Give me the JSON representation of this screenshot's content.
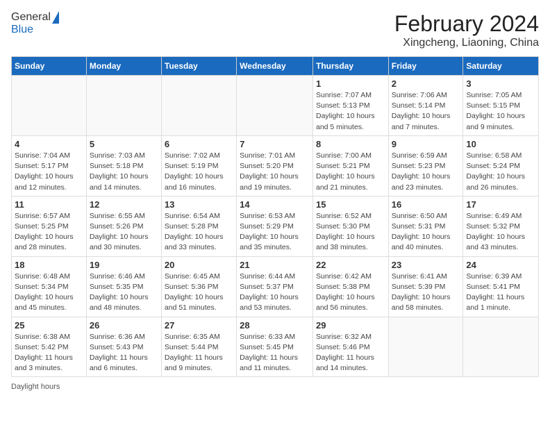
{
  "header": {
    "logo_general": "General",
    "logo_blue": "Blue",
    "title": "February 2024",
    "subtitle": "Xingcheng, Liaoning, China"
  },
  "days_of_week": [
    "Sunday",
    "Monday",
    "Tuesday",
    "Wednesday",
    "Thursday",
    "Friday",
    "Saturday"
  ],
  "weeks": [
    [
      {
        "day": "",
        "info": ""
      },
      {
        "day": "",
        "info": ""
      },
      {
        "day": "",
        "info": ""
      },
      {
        "day": "",
        "info": ""
      },
      {
        "day": "1",
        "info": "Sunrise: 7:07 AM\nSunset: 5:13 PM\nDaylight: 10 hours and 5 minutes."
      },
      {
        "day": "2",
        "info": "Sunrise: 7:06 AM\nSunset: 5:14 PM\nDaylight: 10 hours and 7 minutes."
      },
      {
        "day": "3",
        "info": "Sunrise: 7:05 AM\nSunset: 5:15 PM\nDaylight: 10 hours and 9 minutes."
      }
    ],
    [
      {
        "day": "4",
        "info": "Sunrise: 7:04 AM\nSunset: 5:17 PM\nDaylight: 10 hours and 12 minutes."
      },
      {
        "day": "5",
        "info": "Sunrise: 7:03 AM\nSunset: 5:18 PM\nDaylight: 10 hours and 14 minutes."
      },
      {
        "day": "6",
        "info": "Sunrise: 7:02 AM\nSunset: 5:19 PM\nDaylight: 10 hours and 16 minutes."
      },
      {
        "day": "7",
        "info": "Sunrise: 7:01 AM\nSunset: 5:20 PM\nDaylight: 10 hours and 19 minutes."
      },
      {
        "day": "8",
        "info": "Sunrise: 7:00 AM\nSunset: 5:21 PM\nDaylight: 10 hours and 21 minutes."
      },
      {
        "day": "9",
        "info": "Sunrise: 6:59 AM\nSunset: 5:23 PM\nDaylight: 10 hours and 23 minutes."
      },
      {
        "day": "10",
        "info": "Sunrise: 6:58 AM\nSunset: 5:24 PM\nDaylight: 10 hours and 26 minutes."
      }
    ],
    [
      {
        "day": "11",
        "info": "Sunrise: 6:57 AM\nSunset: 5:25 PM\nDaylight: 10 hours and 28 minutes."
      },
      {
        "day": "12",
        "info": "Sunrise: 6:55 AM\nSunset: 5:26 PM\nDaylight: 10 hours and 30 minutes."
      },
      {
        "day": "13",
        "info": "Sunrise: 6:54 AM\nSunset: 5:28 PM\nDaylight: 10 hours and 33 minutes."
      },
      {
        "day": "14",
        "info": "Sunrise: 6:53 AM\nSunset: 5:29 PM\nDaylight: 10 hours and 35 minutes."
      },
      {
        "day": "15",
        "info": "Sunrise: 6:52 AM\nSunset: 5:30 PM\nDaylight: 10 hours and 38 minutes."
      },
      {
        "day": "16",
        "info": "Sunrise: 6:50 AM\nSunset: 5:31 PM\nDaylight: 10 hours and 40 minutes."
      },
      {
        "day": "17",
        "info": "Sunrise: 6:49 AM\nSunset: 5:32 PM\nDaylight: 10 hours and 43 minutes."
      }
    ],
    [
      {
        "day": "18",
        "info": "Sunrise: 6:48 AM\nSunset: 5:34 PM\nDaylight: 10 hours and 45 minutes."
      },
      {
        "day": "19",
        "info": "Sunrise: 6:46 AM\nSunset: 5:35 PM\nDaylight: 10 hours and 48 minutes."
      },
      {
        "day": "20",
        "info": "Sunrise: 6:45 AM\nSunset: 5:36 PM\nDaylight: 10 hours and 51 minutes."
      },
      {
        "day": "21",
        "info": "Sunrise: 6:44 AM\nSunset: 5:37 PM\nDaylight: 10 hours and 53 minutes."
      },
      {
        "day": "22",
        "info": "Sunrise: 6:42 AM\nSunset: 5:38 PM\nDaylight: 10 hours and 56 minutes."
      },
      {
        "day": "23",
        "info": "Sunrise: 6:41 AM\nSunset: 5:39 PM\nDaylight: 10 hours and 58 minutes."
      },
      {
        "day": "24",
        "info": "Sunrise: 6:39 AM\nSunset: 5:41 PM\nDaylight: 11 hours and 1 minute."
      }
    ],
    [
      {
        "day": "25",
        "info": "Sunrise: 6:38 AM\nSunset: 5:42 PM\nDaylight: 11 hours and 3 minutes."
      },
      {
        "day": "26",
        "info": "Sunrise: 6:36 AM\nSunset: 5:43 PM\nDaylight: 11 hours and 6 minutes."
      },
      {
        "day": "27",
        "info": "Sunrise: 6:35 AM\nSunset: 5:44 PM\nDaylight: 11 hours and 9 minutes."
      },
      {
        "day": "28",
        "info": "Sunrise: 6:33 AM\nSunset: 5:45 PM\nDaylight: 11 hours and 11 minutes."
      },
      {
        "day": "29",
        "info": "Sunrise: 6:32 AM\nSunset: 5:46 PM\nDaylight: 11 hours and 14 minutes."
      },
      {
        "day": "",
        "info": ""
      },
      {
        "day": "",
        "info": ""
      }
    ]
  ],
  "footer": "Daylight hours"
}
